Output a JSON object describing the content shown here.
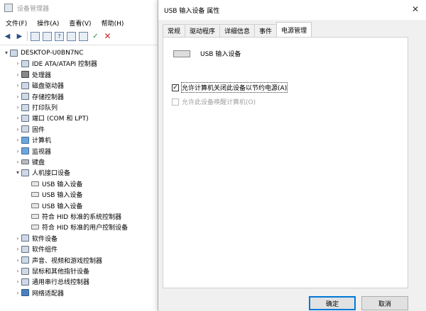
{
  "devmgr": {
    "title": "设备管理器",
    "menu": [
      "文件(F)",
      "操作(A)",
      "查看(V)",
      "帮助(H)"
    ],
    "tree": [
      {
        "label": "DESKTOP-U0BN7NC",
        "level": 0,
        "arrow": "▾",
        "icon": "computer"
      },
      {
        "label": "IDE ATA/ATAPI 控制器",
        "level": 1,
        "arrow": "›",
        "icon": "ide"
      },
      {
        "label": "处理器",
        "level": 1,
        "arrow": "›",
        "icon": "cpu"
      },
      {
        "label": "磁盘驱动器",
        "level": 1,
        "arrow": "›",
        "icon": "disk"
      },
      {
        "label": "存储控制器",
        "level": 1,
        "arrow": "›",
        "icon": "storage"
      },
      {
        "label": "打印队列",
        "level": 1,
        "arrow": "›",
        "icon": "printer"
      },
      {
        "label": "端口 (COM 和 LPT)",
        "level": 1,
        "arrow": "›",
        "icon": "port"
      },
      {
        "label": "固件",
        "level": 1,
        "arrow": "›",
        "icon": "firmware"
      },
      {
        "label": "计算机",
        "level": 1,
        "arrow": "›",
        "icon": "monitor"
      },
      {
        "label": "监视器",
        "level": 1,
        "arrow": "›",
        "icon": "monitor"
      },
      {
        "label": "键盘",
        "level": 1,
        "arrow": "›",
        "icon": "keyboard"
      },
      {
        "label": "人机接口设备",
        "level": 1,
        "arrow": "▾",
        "icon": "hid"
      },
      {
        "label": "USB 输入设备",
        "level": 2,
        "arrow": "",
        "icon": "usb"
      },
      {
        "label": "USB 输入设备",
        "level": 2,
        "arrow": "",
        "icon": "usb"
      },
      {
        "label": "USB 输入设备",
        "level": 2,
        "arrow": "",
        "icon": "usb"
      },
      {
        "label": "符合 HID 标准的系统控制器",
        "level": 2,
        "arrow": "",
        "icon": "usb"
      },
      {
        "label": "符合 HID 标准的用户控制设备",
        "level": 2,
        "arrow": "",
        "icon": "usb"
      },
      {
        "label": "软件设备",
        "level": 1,
        "arrow": "›",
        "icon": "software"
      },
      {
        "label": "软件组件",
        "level": 1,
        "arrow": "›",
        "icon": "software"
      },
      {
        "label": "声音、视频和游戏控制器",
        "level": 1,
        "arrow": "›",
        "icon": "sound"
      },
      {
        "label": "鼠标和其他指针设备",
        "level": 1,
        "arrow": "›",
        "icon": "mouse"
      },
      {
        "label": "通用串行总线控制器",
        "level": 1,
        "arrow": "›",
        "icon": "usb-ctrl"
      },
      {
        "label": "网络适配器",
        "level": 1,
        "arrow": "›",
        "icon": "network"
      }
    ]
  },
  "dialog": {
    "title": "USB 输入设备 属性",
    "close": "✕",
    "tabs": [
      "常规",
      "驱动程序",
      "详细信息",
      "事件",
      "电源管理"
    ],
    "device_name": "USB 输入设备",
    "options": [
      {
        "label": "允许计算机关闭此设备以节约电源(A)",
        "checked": true,
        "enabled": true
      },
      {
        "label": "允许此设备唤醒计算机(O)",
        "checked": false,
        "enabled": false
      }
    ],
    "ok_label": "确定",
    "cancel_label": "取消",
    "check_mark": "✓"
  },
  "toolbar": {
    "back": "◀",
    "forward": "▶",
    "help": "?",
    "scan": "✓",
    "remove": "✕"
  }
}
